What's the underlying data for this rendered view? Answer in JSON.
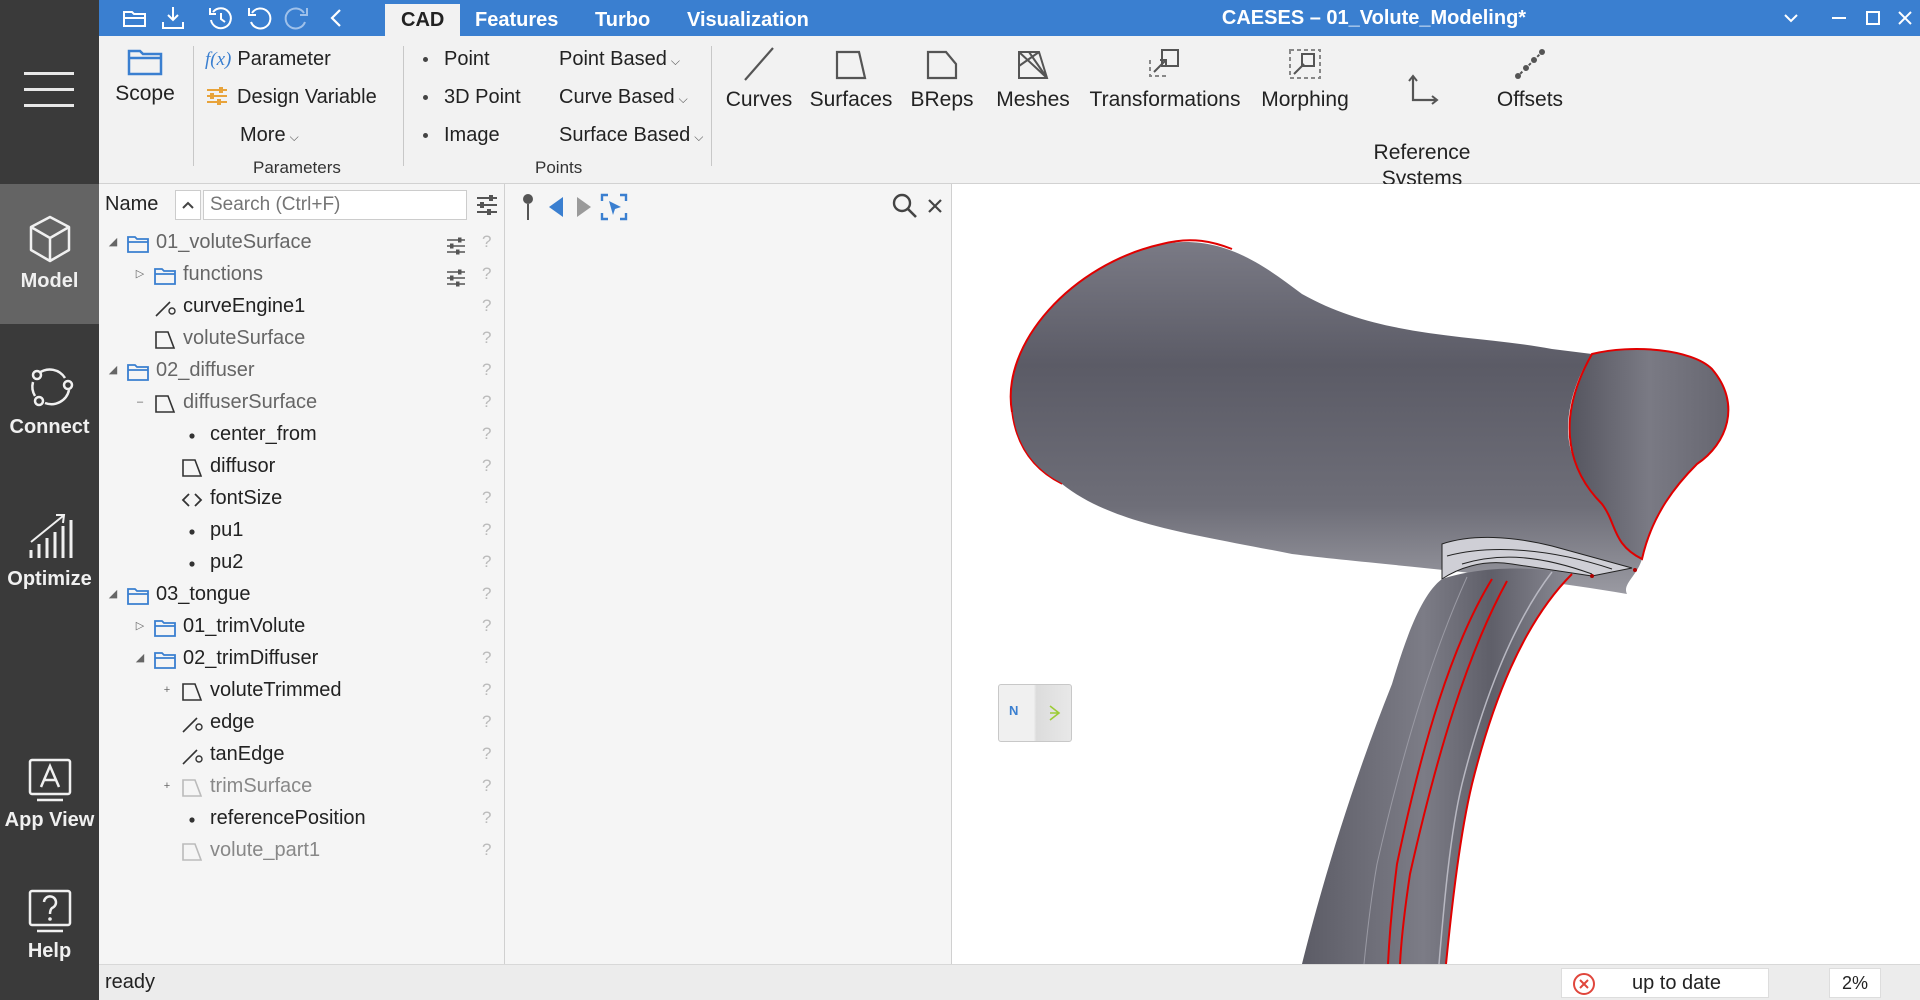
{
  "app": {
    "title": "CAESES – 01_Volute_Modeling*",
    "accent_color": "#3a7fd0",
    "nav_items": [
      {
        "label": "Model",
        "icon": "cube-icon",
        "active": true
      },
      {
        "label": "Connect",
        "icon": "connect-icon",
        "active": false
      },
      {
        "label": "Optimize",
        "icon": "optimize-chart-icon",
        "active": false
      },
      {
        "label": "App View",
        "icon": "app-view-icon",
        "active": false
      },
      {
        "label": "Help",
        "icon": "help-icon",
        "active": false
      }
    ],
    "quick_access_icons": [
      "open-folder-icon",
      "save-download-icon",
      "history-icon",
      "undo-icon",
      "redo-icon",
      "back-arrow-icon"
    ],
    "tabs": [
      {
        "label": "CAD",
        "active": true
      },
      {
        "label": "Features",
        "active": false
      },
      {
        "label": "Turbo",
        "active": false
      },
      {
        "label": "Visualization",
        "active": false
      }
    ]
  },
  "ribbon": {
    "scope": {
      "label": "Scope",
      "icon": "folder-icon"
    },
    "parameters": {
      "fx_prefix": "f(x)",
      "parameter_label": "Parameter",
      "design_variable_label": "Design Variable",
      "more_label": "More",
      "group_label": "Parameters"
    },
    "points": {
      "point_label": "Point",
      "point3d_label": "3D Point",
      "image_label": "Image",
      "point_based_label": "Point Based",
      "curve_based_label": "Curve Based",
      "surface_based_label": "Surface Based",
      "group_label": "Points"
    },
    "tools": [
      {
        "label": "Curves",
        "icon": "curve-icon"
      },
      {
        "label": "Surfaces",
        "icon": "surface-icon"
      },
      {
        "label": "BReps",
        "icon": "brep-icon"
      },
      {
        "label": "Meshes",
        "icon": "mesh-icon"
      },
      {
        "label": "Transformations",
        "icon": "transformations-icon"
      },
      {
        "label": "Morphing",
        "icon": "morphing-icon"
      },
      {
        "label": "Reference\nSystems",
        "icon": "reference-systems-icon"
      },
      {
        "label": "Offsets",
        "icon": "offsets-icon"
      }
    ]
  },
  "tree": {
    "header_name": "Name",
    "search_placeholder": "Search (Ctrl+F)",
    "rows": [
      {
        "label": "01_voluteSurface",
        "type": "folder",
        "depth": 0,
        "expand": "open",
        "style": "dim",
        "sliders": true
      },
      {
        "label": "functions",
        "type": "folder",
        "depth": 1,
        "expand": "closed",
        "style": "dim",
        "sliders": true
      },
      {
        "label": "curveEngine1",
        "type": "curve",
        "depth": 1,
        "expand": "",
        "style": "normal"
      },
      {
        "label": "voluteSurface",
        "type": "surface",
        "depth": 1,
        "expand": "",
        "style": "dim"
      },
      {
        "label": "02_diffuser",
        "type": "folder",
        "depth": 0,
        "expand": "open",
        "style": "dim"
      },
      {
        "label": "diffuserSurface",
        "type": "surface",
        "depth": 1,
        "expand": "minus",
        "style": "dim"
      },
      {
        "label": "center_from",
        "type": "point",
        "depth": 2,
        "expand": "",
        "style": "normal"
      },
      {
        "label": "diffusor",
        "type": "surface",
        "depth": 2,
        "expand": "",
        "style": "normal"
      },
      {
        "label": "fontSize",
        "type": "code",
        "depth": 2,
        "expand": "",
        "style": "normal"
      },
      {
        "label": "pu1",
        "type": "point",
        "depth": 2,
        "expand": "",
        "style": "normal"
      },
      {
        "label": "pu2",
        "type": "point",
        "depth": 2,
        "expand": "",
        "style": "normal"
      },
      {
        "label": "03_tongue",
        "type": "folder",
        "depth": 0,
        "expand": "open",
        "style": "normal"
      },
      {
        "label": "01_trimVolute",
        "type": "folder",
        "depth": 1,
        "expand": "closed",
        "style": "normal"
      },
      {
        "label": "02_trimDiffuser",
        "type": "folder",
        "depth": 1,
        "expand": "open",
        "style": "normal"
      },
      {
        "label": "voluteTrimmed",
        "type": "surface",
        "depth": 2,
        "expand": "plus",
        "style": "normal"
      },
      {
        "label": "edge",
        "type": "curve",
        "depth": 2,
        "expand": "",
        "style": "normal"
      },
      {
        "label": "tanEdge",
        "type": "curve",
        "depth": 2,
        "expand": "",
        "style": "normal"
      },
      {
        "label": "trimSurface",
        "type": "surface-faint",
        "depth": 2,
        "expand": "plus",
        "style": "faint"
      },
      {
        "label": "referencePosition",
        "type": "point",
        "depth": 2,
        "expand": "",
        "style": "normal"
      },
      {
        "label": "volute_part1",
        "type": "surface-faint",
        "depth": 2,
        "expand": "",
        "style": "faint"
      }
    ]
  },
  "viewcube": {
    "face_front": "N"
  },
  "status": {
    "text": "ready",
    "state": "up to date",
    "percent": "2%",
    "error_color": "#e0463c"
  }
}
